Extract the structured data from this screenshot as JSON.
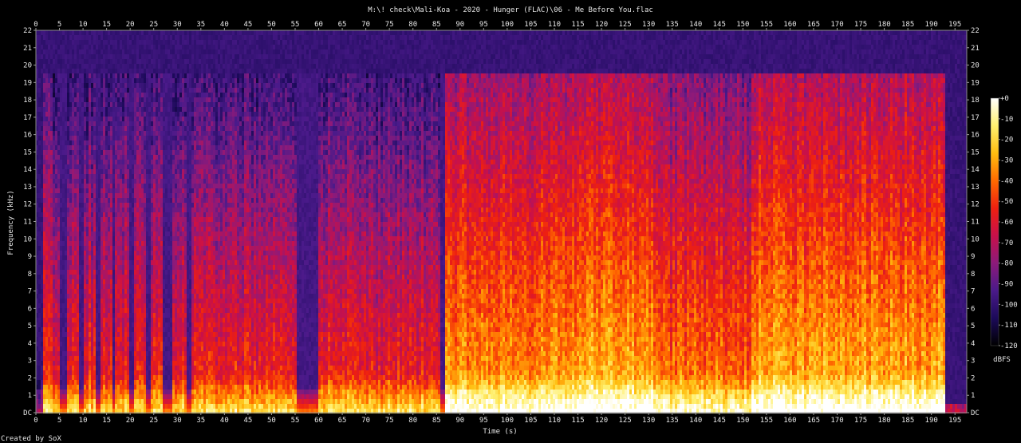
{
  "chart_data": {
    "type": "heatmap",
    "title": "M:\\! check\\Mali-Koa - 2020 - Hunger (FLAC)\\06 - Me Before You.flac",
    "xlabel": "Time (s)",
    "ylabel": "Frequency (kHz)",
    "credit": "Created by SoX",
    "xlim": [
      0,
      197.5
    ],
    "ylim": [
      0,
      22
    ],
    "x_ticks": [
      "0",
      "5",
      "10",
      "15",
      "20",
      "25",
      "30",
      "35",
      "40",
      "45",
      "50",
      "55",
      "60",
      "65",
      "70",
      "75",
      "80",
      "85",
      "90",
      "95",
      "100",
      "105",
      "110",
      "115",
      "120",
      "125",
      "130",
      "135",
      "140",
      "145",
      "150",
      "155",
      "160",
      "165",
      "170",
      "175",
      "180",
      "185",
      "190",
      "195"
    ],
    "y_ticks": [
      "DC",
      "1",
      "2",
      "3",
      "4",
      "5",
      "6",
      "7",
      "8",
      "9",
      "10",
      "11",
      "12",
      "13",
      "14",
      "15",
      "16",
      "17",
      "18",
      "19",
      "20",
      "21",
      "22"
    ],
    "colorbar": {
      "label": "dBFS",
      "range": [
        -120,
        0
      ],
      "ticks": [
        "+0",
        "-10",
        "-20",
        "-30",
        "-40",
        "-50",
        "-60",
        "-70",
        "-80",
        "-90",
        "-100",
        "-110",
        "-120"
      ]
    },
    "colors": {
      "background": "#000000",
      "colormap": [
        "#000000",
        "#1c0a5a",
        "#4a1a8a",
        "#8c1a7a",
        "#c8104a",
        "#ee2010",
        "#ff6a00",
        "#ffbe10",
        "#fff070",
        "#ffffff"
      ]
    },
    "segments": [
      {
        "t0": 0,
        "t1": 1.5,
        "cutoff_khz": 2,
        "energy": 0.15
      },
      {
        "t0": 1.5,
        "t1": 87,
        "cutoff_khz": 19.5,
        "energy": 0.58
      },
      {
        "t0": 87,
        "t1": 110,
        "cutoff_khz": 19.5,
        "energy": 0.76
      },
      {
        "t0": 110,
        "t1": 131,
        "cutoff_khz": 19.5,
        "energy": 0.8
      },
      {
        "t0": 131,
        "t1": 152,
        "cutoff_khz": 19.5,
        "energy": 0.7
      },
      {
        "t0": 152,
        "t1": 193,
        "cutoff_khz": 19.5,
        "energy": 0.8
      },
      {
        "t0": 193,
        "t1": 197.5,
        "cutoff_khz": 0.5,
        "energy": 0.22
      }
    ],
    "quiet_gaps": [
      {
        "t0": 5,
        "t1": 6.5
      },
      {
        "t0": 9,
        "t1": 10.2
      },
      {
        "t0": 12.5,
        "t1": 13.5
      },
      {
        "t0": 16,
        "t1": 17
      },
      {
        "t0": 20,
        "t1": 21
      },
      {
        "t0": 23.5,
        "t1": 24.3
      },
      {
        "t0": 27,
        "t1": 29
      },
      {
        "t0": 32,
        "t1": 33
      },
      {
        "t0": 55.5,
        "t1": 60
      },
      {
        "t0": 86,
        "t1": 87
      }
    ]
  }
}
